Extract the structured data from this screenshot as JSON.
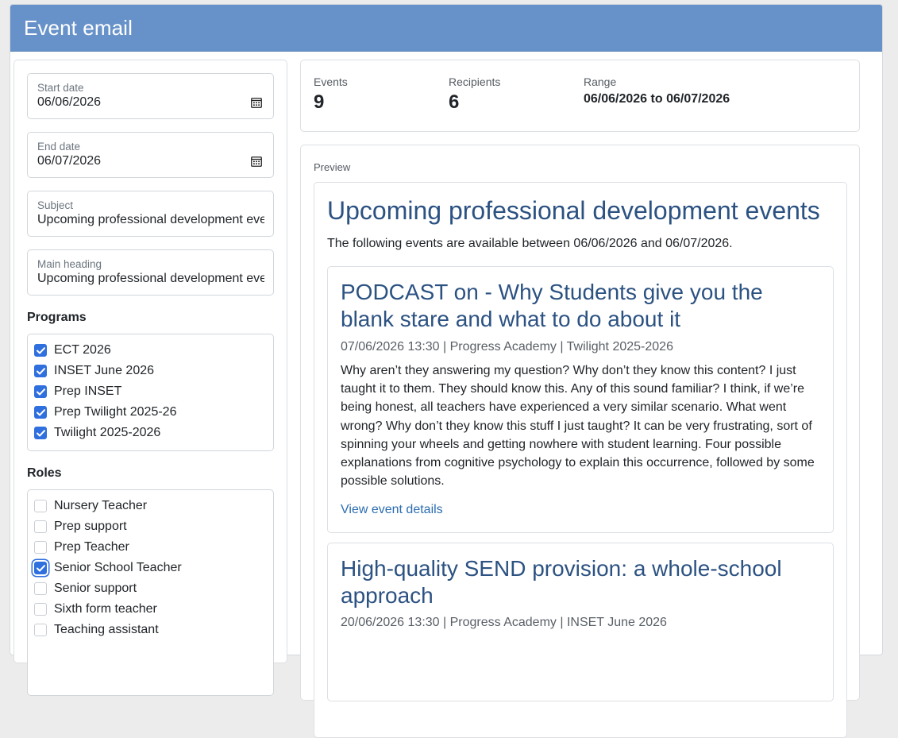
{
  "window": {
    "title": "Event email"
  },
  "form": {
    "start_date": {
      "label": "Start date",
      "value": "06/06/2026",
      "icon": "calendar-icon"
    },
    "end_date": {
      "label": "End date",
      "value": "06/07/2026",
      "icon": "calendar-icon"
    },
    "subject": {
      "label": "Subject",
      "value": "Upcoming professional development eve"
    },
    "main_heading": {
      "label": "Main heading",
      "value": "Upcoming professional development eve"
    }
  },
  "programs": {
    "title": "Programs",
    "items": [
      {
        "label": "ECT 2026",
        "checked": true
      },
      {
        "label": "INSET June 2026",
        "checked": true
      },
      {
        "label": "Prep INSET",
        "checked": true
      },
      {
        "label": "Prep Twilight 2025-26",
        "checked": true
      },
      {
        "label": "Twilight 2025-2026",
        "checked": true
      }
    ]
  },
  "roles": {
    "title": "Roles",
    "items": [
      {
        "label": "Nursery Teacher",
        "checked": false
      },
      {
        "label": "Prep support",
        "checked": false
      },
      {
        "label": "Prep Teacher",
        "checked": false
      },
      {
        "label": "Senior School Teacher",
        "checked": true,
        "focused": true
      },
      {
        "label": "Senior support",
        "checked": false
      },
      {
        "label": "Sixth form teacher",
        "checked": false
      },
      {
        "label": "Teaching assistant",
        "checked": false
      }
    ]
  },
  "stats": {
    "events": {
      "label": "Events",
      "value": "9"
    },
    "recipients": {
      "label": "Recipients",
      "value": "6"
    },
    "range": {
      "label": "Range",
      "value": "06/06/2026 to 06/07/2026"
    }
  },
  "preview": {
    "label": "Preview",
    "heading": "Upcoming professional development events",
    "intro": "The following events are available between 06/06/2026 and 06/07/2026.",
    "events": [
      {
        "title": "PODCAST on - Why Students give you the blank stare and what to do about it",
        "meta": "07/06/2026 13:30 | Progress Academy | Twilight 2025-2026",
        "description": "Why aren’t they answering my question? Why don’t they know this content? I just taught it to them. They should know this. Any of this sound familiar? I think, if we’re being honest, all teachers have experienced a very similar scenario. What went wrong? Why don’t they know this stuff I just taught? It can be very frustrating, sort of spinning your wheels and getting nowhere with student learning. Four possible explanations from cognitive psychology to explain this occurrence, followed by some possible solutions.",
        "link": "View event details"
      },
      {
        "title": "High-quality SEND provision: a whole-school approach",
        "meta": "20/06/2026 13:30 | Progress Academy | INSET June 2026"
      }
    ]
  },
  "colors": {
    "header": "#6792c9",
    "accent": "#2f6fde",
    "heading": "#2c5282",
    "link": "#2b6cb0"
  }
}
